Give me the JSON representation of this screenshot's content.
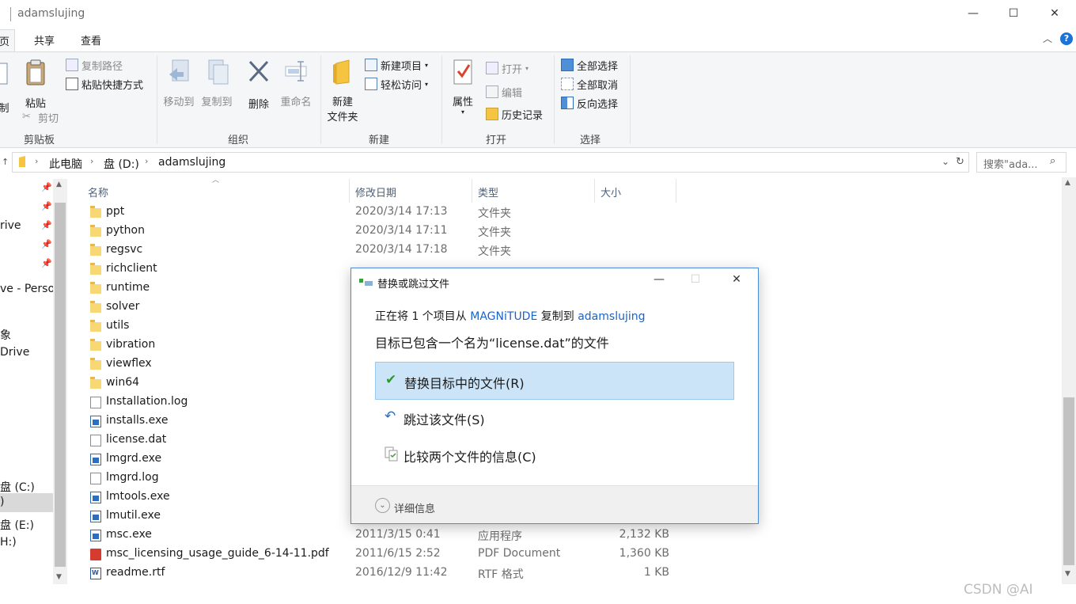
{
  "window": {
    "title": "adamslujing",
    "controls": {
      "minimize": "—",
      "maximize": "☐",
      "close": "✕"
    }
  },
  "tabs": [
    {
      "label": "页"
    },
    {
      "label": "共享"
    },
    {
      "label": "查看"
    }
  ],
  "ribbon": {
    "clipboard": {
      "group_label": "剪贴板",
      "copy_partial": "制",
      "paste": "粘贴",
      "copy_path": "复制路径",
      "paste_shortcut": "粘贴快捷方式",
      "cut": "剪切"
    },
    "organize": {
      "group_label": "组织",
      "move_to": "移动到",
      "copy_to": "复制到",
      "delete": "删除",
      "rename": "重命名"
    },
    "new": {
      "group_label": "新建",
      "new_folder_line1": "新建",
      "new_folder_line2": "文件夹",
      "new_item": "新建项目",
      "easy_access": "轻松访问"
    },
    "open": {
      "group_label": "打开",
      "properties": "属性",
      "open": "打开",
      "edit": "编辑",
      "history": "历史记录"
    },
    "select": {
      "group_label": "选择",
      "select_all": "全部选择",
      "select_none": "全部取消",
      "invert": "反向选择"
    }
  },
  "address": {
    "crumbs": [
      "此电脑",
      "盘 (D:)",
      "adamslujing"
    ],
    "search_placeholder": "搜索\"ada..."
  },
  "nav": {
    "items": [
      "rive",
      "ve - Perso",
      "象",
      "Drive",
      "盘 (C:)",
      ")",
      "盘 (E:)",
      "H:)"
    ]
  },
  "columns": {
    "name": "名称",
    "date": "修改日期",
    "type": "类型",
    "size": "大小"
  },
  "files": [
    {
      "name": "ppt",
      "date": "2020/3/14 17:13",
      "type": "文件夹",
      "size": "",
      "kind": "folder"
    },
    {
      "name": "python",
      "date": "2020/3/14 17:11",
      "type": "文件夹",
      "size": "",
      "kind": "folder"
    },
    {
      "name": "regsvc",
      "date": "2020/3/14 17:18",
      "type": "文件夹",
      "size": "",
      "kind": "folder"
    },
    {
      "name": "richclient",
      "date": "",
      "type": "",
      "size": "",
      "kind": "folder"
    },
    {
      "name": "runtime",
      "date": "",
      "type": "",
      "size": "",
      "kind": "folder"
    },
    {
      "name": "solver",
      "date": "",
      "type": "",
      "size": "",
      "kind": "folder"
    },
    {
      "name": "utils",
      "date": "",
      "type": "",
      "size": "",
      "kind": "folder"
    },
    {
      "name": "vibration",
      "date": "",
      "type": "",
      "size": "",
      "kind": "folder"
    },
    {
      "name": "viewflex",
      "date": "",
      "type": "",
      "size": "",
      "kind": "folder"
    },
    {
      "name": "win64",
      "date": "",
      "type": "",
      "size": "",
      "kind": "folder"
    },
    {
      "name": "Installation.log",
      "date": "",
      "type": "",
      "size": "",
      "kind": "doc"
    },
    {
      "name": "installs.exe",
      "date": "",
      "type": "",
      "size": "",
      "kind": "exe"
    },
    {
      "name": "license.dat",
      "date": "",
      "type": "",
      "size": "",
      "kind": "doc"
    },
    {
      "name": "lmgrd.exe",
      "date": "",
      "type": "",
      "size": "",
      "kind": "exe"
    },
    {
      "name": "lmgrd.log",
      "date": "",
      "type": "",
      "size": "",
      "kind": "doc"
    },
    {
      "name": "lmtools.exe",
      "date": "",
      "type": "",
      "size": "",
      "kind": "exe"
    },
    {
      "name": "lmutil.exe",
      "date": "",
      "type": "",
      "size": "",
      "kind": "exe"
    },
    {
      "name": "msc.exe",
      "date": "2011/3/15 0:41",
      "type": "应用程序",
      "size": "2,132 KB",
      "kind": "exe"
    },
    {
      "name": "msc_licensing_usage_guide_6-14-11.pdf",
      "date": "2011/6/15 2:52",
      "type": "PDF Document",
      "size": "1,360 KB",
      "kind": "pdf"
    },
    {
      "name": "readme.rtf",
      "date": "2016/12/9 11:42",
      "type": "RTF 格式",
      "size": "1 KB",
      "kind": "rtf"
    }
  ],
  "dialog": {
    "title": "替换或跳过文件",
    "line1_prefix": "正在将 1 个项目从 ",
    "source": "MAGNiTUDE",
    "line1_middle": " 复制到 ",
    "destination": "adamslujing",
    "line2": "目标已包含一个名为“license.dat”的文件",
    "options": {
      "replace": "替换目标中的文件(R)",
      "skip": "跳过该文件(S)",
      "compare": "比较两个文件的信息(C)"
    },
    "more_details": "详细信息"
  },
  "watermark": "CSDN @AI"
}
